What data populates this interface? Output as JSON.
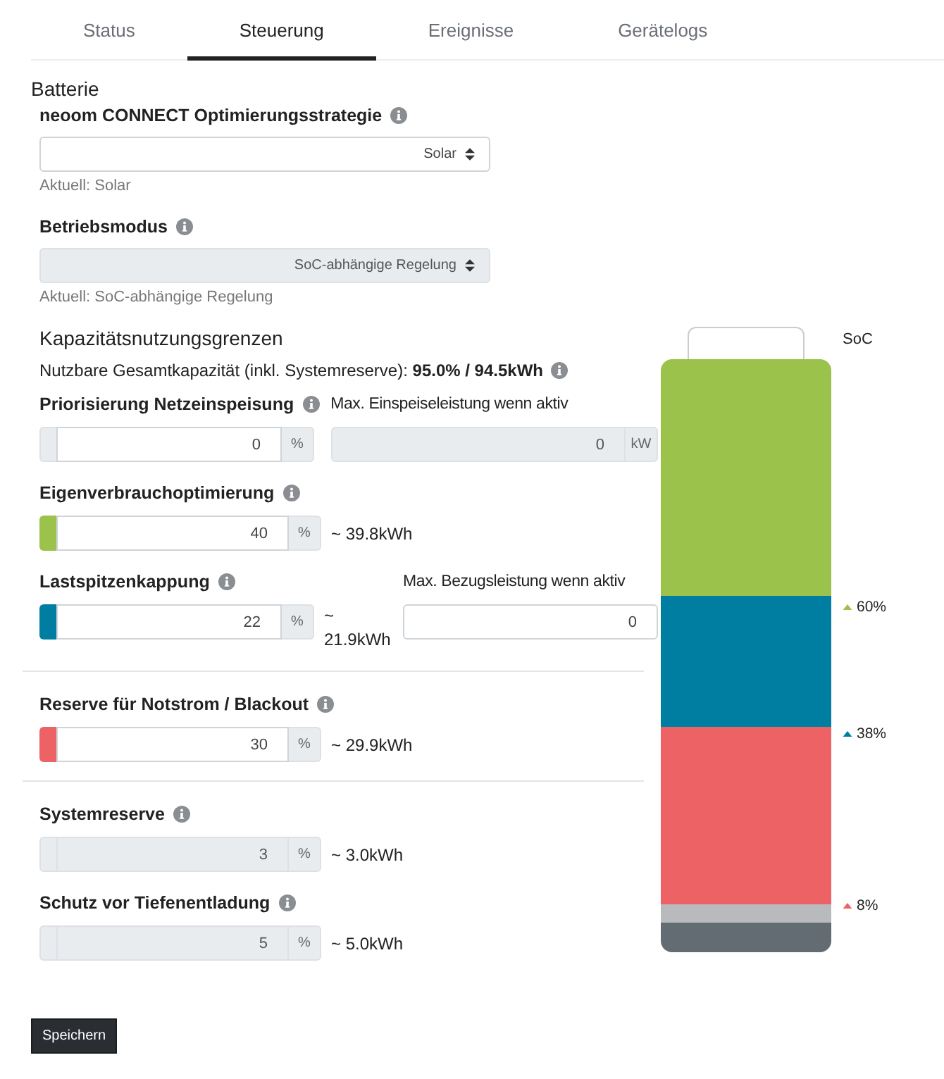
{
  "tabs": [
    {
      "label": "Status",
      "selected": false
    },
    {
      "label": "Steuerung",
      "selected": true
    },
    {
      "label": "Ereignisse",
      "selected": false
    },
    {
      "label": "Gerätelogs",
      "selected": false
    }
  ],
  "section_title": "Batterie",
  "selects": [
    {
      "label": "neoom CONNECT Optimierungsstrategie",
      "value": "Solar",
      "disabled": false,
      "current": "Aktuell: Solar"
    },
    {
      "label": "Betriebsmodus",
      "value": "SoC-abhängige Regelung",
      "disabled": true,
      "current": "Aktuell: SoC-abhängige Regelung"
    }
  ],
  "capacity": {
    "title": "Kapazitätsnutzungsgrenzen",
    "summary": "Nutzbare Gesamtkapazität (inkl. Systemreserve): **95.0% / 94.5kWh**"
  },
  "limits": [
    {
      "label": "Priorisierung Netzeinspeisung",
      "value": "0",
      "unit": "%",
      "disabled": false,
      "divider_after": false,
      "side": {
        "label": "Max. Einspeiseleistung wenn aktiv",
        "value": "0",
        "unit": "kW",
        "disabled": true
      }
    },
    {
      "label": "Eigenverbrauchoptimierung",
      "value": "40",
      "unit": "%",
      "disabled": false,
      "color": "#9bc24a",
      "estimate": "~ 39.8kWh",
      "divider_after": false
    },
    {
      "label": "Lastspitzenkappung",
      "value": "22",
      "unit": "%",
      "disabled": false,
      "color": "#007ea1",
      "estimate": "~ 21.9kWh",
      "divider_after": true,
      "side": {
        "label": "Max. Bezugsleistung wenn aktiv",
        "value": "0",
        "disabled": false
      }
    },
    {
      "label": "Reserve für Notstrom / Blackout",
      "value": "30",
      "unit": "%",
      "disabled": false,
      "color": "#ec6265",
      "estimate": "~ 29.9kWh",
      "divider_after": true
    },
    {
      "label": "Systemreserve",
      "value": "3",
      "unit": "%",
      "disabled": true,
      "estimate": "~ 3.0kWh",
      "divider_after": false
    },
    {
      "label": "Schutz vor Tiefenentladung",
      "value": "5",
      "unit": "%",
      "disabled": true,
      "estimate": "~ 5.0kWh",
      "divider_after": false
    }
  ],
  "save_button": "Speichern",
  "battery": {
    "label": "SoC",
    "segments": [
      {
        "color": "#9bc24a"
      },
      {
        "color": "#007ea1"
      },
      {
        "color": "#ec6265"
      },
      {
        "color": "#b8babd"
      },
      {
        "color": "#636b73"
      }
    ],
    "markers": [
      {
        "label": "60%",
        "color": "#9bc24a"
      },
      {
        "label": "38%",
        "color": "#007ea1"
      },
      {
        "label": "8%",
        "color": "#ec6265"
      }
    ]
  }
}
